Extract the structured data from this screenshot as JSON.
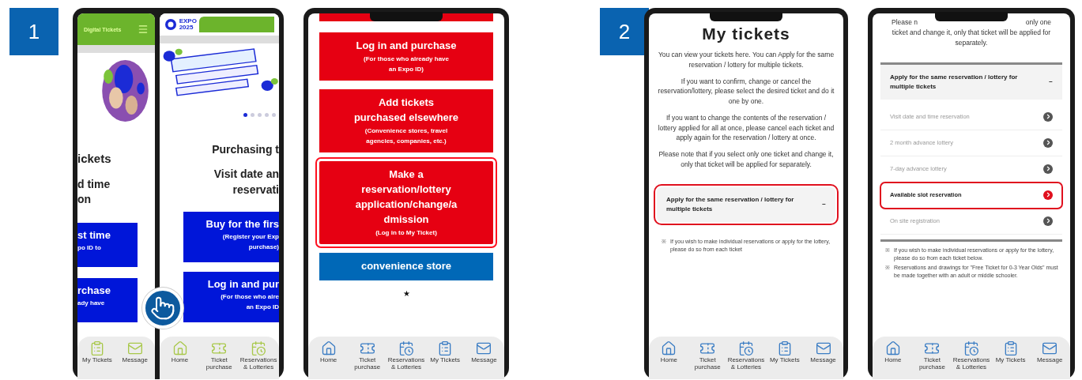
{
  "steps": [
    {
      "number": "1",
      "screens": [
        {
          "kind": "split",
          "left": {
            "header": "Digital Tickets",
            "title": "ickets",
            "subtitle": [
              "d time",
              "on"
            ],
            "buttons": [
              {
                "title": "st time",
                "note": "po ID to"
              },
              {
                "title": "rchase",
                "note": "ady have"
              }
            ],
            "nav": [
              {
                "kind": "clipboard",
                "label": "My Tickets"
              },
              {
                "kind": "mail",
                "label": "Message"
              }
            ]
          },
          "right": {
            "logo": [
              "EXPO",
              "2025"
            ],
            "dots": [
              {
                "selected": true
              },
              {
                "selected": false
              },
              {
                "selected": false
              },
              {
                "selected": false
              },
              {
                "selected": false
              }
            ],
            "title": "Purchasing t",
            "subtitle": [
              "Visit date an",
              "reservati"
            ],
            "buttons": [
              {
                "title": "Buy for the firs",
                "note": [
                  "(Register your Exp",
                  "purchase)"
                ]
              },
              {
                "title": "Log in and pur",
                "note": [
                  "(For those who alre",
                  "an Expo ID"
                ]
              }
            ],
            "nav": [
              {
                "kind": "home",
                "label": "Home"
              },
              {
                "kind": "ticket",
                "label": "Ticket purchase"
              },
              {
                "kind": "calendar",
                "label": "Reservations & Lotteries"
              }
            ]
          }
        },
        {
          "kind": "menu",
          "buttons": [
            {
              "title": [
                "Log in and purchase"
              ],
              "note": [
                "(For those who already have",
                "an Expo ID)"
              ],
              "color": "#e60012",
              "highlighted": false
            },
            {
              "title": [
                "Add tickets",
                "purchased elsewhere"
              ],
              "note": [
                "(Convenience stores, travel",
                "agencies, companies, etc.)"
              ],
              "color": "#e60012",
              "highlighted": false
            },
            {
              "title": [
                "Make a",
                "reservation/lottery",
                "application/change/a",
                "dmission"
              ],
              "note": [
                "(Log in to My Ticket)"
              ],
              "color": "#e60012",
              "highlighted": true
            },
            {
              "title": [
                "convenience store"
              ],
              "color": "#0068b7",
              "highlighted": false
            }
          ],
          "mark": "★",
          "nav": [
            {
              "kind": "home",
              "label": "Home"
            },
            {
              "kind": "ticket",
              "label": "Ticket purchase"
            },
            {
              "kind": "calendar",
              "label": "Reservations & Lotteries"
            },
            {
              "kind": "clipboard",
              "label": "My Tickets"
            },
            {
              "kind": "mail",
              "label": "Message"
            }
          ]
        }
      ]
    },
    {
      "number": "2",
      "screens": [
        {
          "kind": "my_tickets",
          "title": "My tickets",
          "paragraphs": [
            "You can view your tickets here. You can Apply for the same reservation / lottery for multiple tickets.",
            "If you want to confirm, change or cancel the reservation/lottery, please select the desired ticket and do it one by one.",
            "If you want to change the contents of the reservation / lottery applied for all at once, please cancel each ticket and apply again for the reservation / lottery at once.",
            "Please note that if you select only one ticket and change it, only that ticket will be applied for separately."
          ],
          "accordion": {
            "label": "Apply for the same reservation / lottery for multiple tickets",
            "toggle": "−",
            "highlighted": true
          },
          "bullets": [
            {
              "marker": "※",
              "text": "If you wish to make individual reservations or apply for the lottery, please do so from each ticket"
            }
          ],
          "nav": [
            {
              "kind": "home",
              "label": "Home"
            },
            {
              "kind": "ticket",
              "label": "Ticket purchase"
            },
            {
              "kind": "calendar",
              "label": "Reservations & Lotteries"
            },
            {
              "kind": "clipboard",
              "label": "My Tickets"
            },
            {
              "kind": "mail",
              "label": "Message"
            }
          ]
        },
        {
          "kind": "reservation_menu",
          "top": [
            "Please n",
            "only one"
          ],
          "intro": "ticket and change it, only that ticket will be applied for separately.",
          "accordion": {
            "label": "Apply for the same reservation / lottery for multiple tickets",
            "toggle": "−",
            "highlighted": false
          },
          "items": [
            {
              "label": "Visit date and time reservation",
              "highlighted": false
            },
            {
              "label": "2 month advance lottery",
              "highlighted": false
            },
            {
              "label": "7-day advance lottery",
              "highlighted": false
            },
            {
              "label": "Available slot reservation",
              "highlighted": true
            },
            {
              "label": "On site registration",
              "highlighted": false
            }
          ],
          "bullets": [
            {
              "marker": "※",
              "text": "If you wish to make individual reservations or apply for the lottery, please do so from each ticket below."
            },
            {
              "marker": "※",
              "text": "Reservations and drawings for \"Free Ticket for 0-3 Year Olds\" must be made together with an adult or middle schooler."
            }
          ],
          "nav": [
            {
              "kind": "home",
              "label": "Home"
            },
            {
              "kind": "ticket",
              "label": "Ticket purchase"
            },
            {
              "kind": "calendar",
              "label": "Reservations & Lotteries"
            },
            {
              "kind": "clipboard",
              "label": "My Tickets"
            },
            {
              "kind": "mail",
              "label": "Message"
            }
          ]
        }
      ]
    }
  ]
}
